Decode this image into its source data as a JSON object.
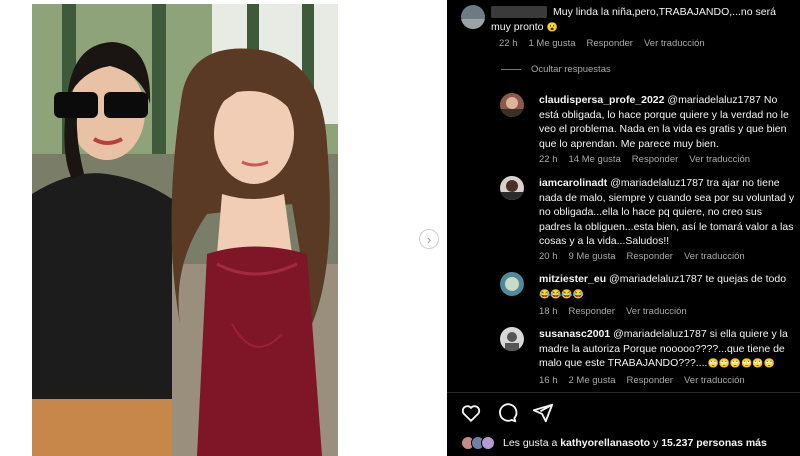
{
  "post": {
    "next_arrow": "›",
    "actions": {
      "like": "heart-icon",
      "comment": "comment-icon",
      "share": "share-icon"
    },
    "likes": {
      "prefix": "Les gusta a ",
      "user": "kathyorellanasoto",
      "middle": " y ",
      "count": "15.237 personas más"
    }
  },
  "comments": {
    "top": {
      "text": "Muy linda la niña,pero,TRABAJANDO,...no será muy pronto",
      "emoji": "😮",
      "time": "22 h",
      "likes": "1 Me gusta",
      "reply": "Responder",
      "translate": "Ver traducción"
    },
    "hide_replies": "Ocultar respuestas",
    "replies": [
      {
        "user": "claudispersa_profe_2022",
        "text": " @mariadelaluz1787 No está obligada, lo hace porque quiere y la verdad no le veo el problema. Nada en la vida es gratis y que bien que lo aprendan. Me parece muy bien.",
        "time": "22 h",
        "likes": "14 Me gusta",
        "reply": "Responder",
        "translate": "Ver traducción"
      },
      {
        "user": "iamcarolinadt",
        "text": " @mariadelaluz1787 tra ajar no tiene nada de malo, siempre y cuando sea por su voluntad y no obligada...ella lo hace pq quiere, no creo sus padres la obliguen...esta bien, así le tomará valor a las cosas y a la vida...Saludos!!",
        "time": "20 h",
        "likes": "9 Me gusta",
        "reply": "Responder",
        "translate": "Ver traducción"
      },
      {
        "user": "mitziester_eu",
        "text": " @mariadelaluz1787 te quejas de todo",
        "emoji": "😂😂😂😂",
        "time": "18 h",
        "likes": "",
        "reply": "Responder",
        "translate": "Ver traducción"
      },
      {
        "user": "susanasc2001",
        "text": " @mariadelaluz1787 si ella quiere y la madre la autoriza Porque nooooo????...que tiene de malo que este TRABAJANDO???....",
        "emoji": "🙄🙄🙄🙄🙄🙄",
        "time": "16 h",
        "likes": "2 Me gusta",
        "reply": "Responder",
        "translate": "Ver traducción"
      }
    ]
  }
}
